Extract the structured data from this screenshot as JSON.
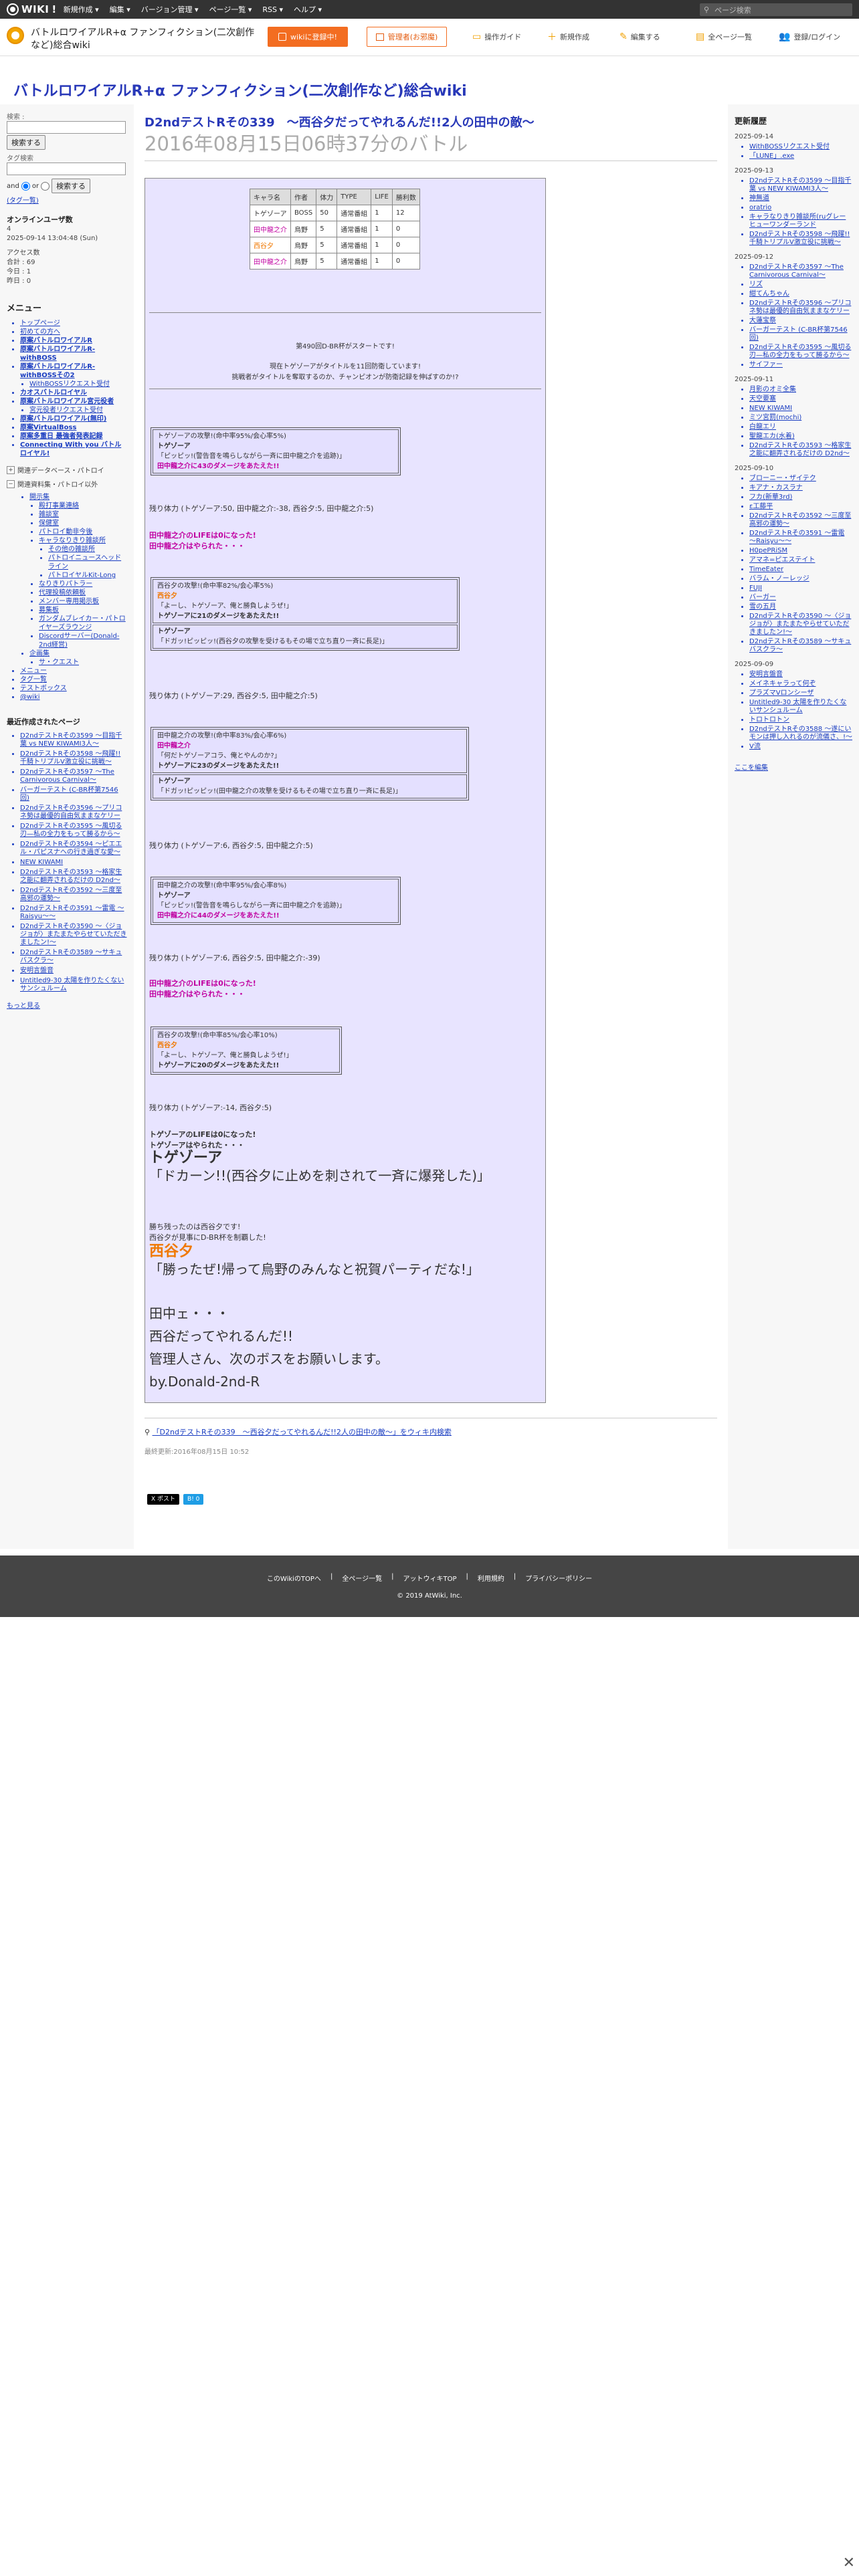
{
  "topbar": {
    "logo": "WIKI",
    "menus": [
      "新規作成 ▾",
      "編集 ▾",
      "バージョン管理 ▾",
      "ページ一覧 ▾",
      "RSS ▾",
      "ヘルプ ▾"
    ],
    "search_placeholder": "ページ検索"
  },
  "header": {
    "site_name": "バトルロワイアルR+α ファンフィクション(二次創作など)総合wiki",
    "wiki_btn": "wikiに登録中!",
    "manage_btn": "管理者(お邪魔)",
    "actions": [
      "操作ガイド",
      "新規作成",
      "編集する",
      "全ページ一覧",
      "登録/ログイン"
    ],
    "site_title": "バトルロワイアルR+α ファンフィクション(二次創作など)総合wiki"
  },
  "left": {
    "search_label": "検索 :",
    "search_btn": "検索する",
    "tag_label": "タグ検索",
    "and_label": "and",
    "or_label": "or",
    "search_btn2": "検索する",
    "tag_list": "(タグ一覧)",
    "online_title": "オンラインユーザ数",
    "online_count": "4",
    "online_time": "2025-09-14 13:04:48 (Sun)",
    "stats_title": "アクセス数",
    "stats": [
      "合計 : 69",
      "今日 : 1",
      "昨日 : 0"
    ],
    "menu_title": "メニュー",
    "menu": [
      {
        "t": "トップページ",
        "c": ""
      },
      {
        "t": "初めての方へ",
        "c": ""
      },
      {
        "t": "原案バトルロワイアルR",
        "c": "b"
      },
      {
        "t": "原案バトルロワイアルR-withBOSS",
        "c": "b"
      },
      {
        "t": "原案バトルロワイアルR-withBOSSその2",
        "c": "b"
      },
      {
        "t": "WithBOSSリクエスト受付",
        "c": "sub"
      },
      {
        "t": "カオスバトルロイヤル",
        "c": "b"
      },
      {
        "t": "原案バトルロワイアル宮元役者",
        "c": "b"
      },
      {
        "t": "宮元役者リクエスト受付",
        "c": "sub"
      },
      {
        "t": "原案バトルロワイアル(無印)",
        "c": "b"
      },
      {
        "t": "原案VirtualBoss",
        "c": "b"
      },
      {
        "t": "原案多重日 最強者発表記録",
        "c": "b"
      },
      {
        "t": "Connecting With you バトルロイヤル!",
        "c": "b"
      }
    ],
    "toggle1": "関連データベース・パトロイ",
    "toggle2": "関連資料集・パトロイ以外",
    "submenu": [
      {
        "t": "開示集",
        "c": "sub"
      },
      {
        "t": "殿打事業連絡",
        "c": "sub2"
      },
      {
        "t": "雑談室",
        "c": "sub2"
      },
      {
        "t": "保健室",
        "c": "sub2"
      },
      {
        "t": "パトロイ動非今後",
        "c": "sub2"
      },
      {
        "t": "キャラなりきり雑談所",
        "c": "sub2"
      },
      {
        "t": "その他の雑談所",
        "c": "sub3"
      },
      {
        "t": "パトロイニュースヘッドライン",
        "c": "sub3"
      },
      {
        "t": "パトロイヤルKit-Long",
        "c": "sub3"
      },
      {
        "t": "なりきりパトラー",
        "c": "sub2"
      },
      {
        "t": "代理投稿依頼板",
        "c": "sub2"
      },
      {
        "t": "メンバー専用掲示板",
        "c": "sub2"
      },
      {
        "t": "募集板",
        "c": "sub2"
      },
      {
        "t": "ガンダムブレイカー・パトロイヤーズラウンジ",
        "c": "sub2"
      },
      {
        "t": "Discordサーバー(Donald-2nd経営)",
        "c": "sub2"
      },
      {
        "t": "企画集",
        "c": "sub"
      },
      {
        "t": "サ・クエスト",
        "c": "sub2"
      },
      {
        "t": "メニュー",
        "c": ""
      },
      {
        "t": "タグ一覧",
        "c": ""
      },
      {
        "t": "テストボックス",
        "c": ""
      },
      {
        "t": "@wiki",
        "c": ""
      }
    ],
    "recent_title": "最近作成されたページ",
    "recent": [
      "D2ndテストRその3599 〜目指千葉 vs NEW KIWAMI3人〜",
      "D2ndテストRその3598 〜飛躍!!千騎トリプルV激立役に挑戦〜",
      "D2ndテストRその3597 〜The Carnivorous Carnival〜",
      "バーガーテスト (C-BR杯第7546回)",
      "D2ndテストRその3596 〜プリコネ勢は最優的自由気ままなケリー",
      "D2ndテストRその3595 〜風切る刃—私の全力をもって勝るから〜",
      "D2ndテストRその3594 〜ピエエル・パピスナへの行き過ぎな愛〜",
      "NEW KIWAMI",
      "D2ndテストRその3593 〜格家生之能に翻弄されるだけの D2nd〜",
      "D2ndテストRその3592 〜三度至高邪の運勢〜",
      "D2ndテストRその3591 〜雷電 〜Raisyu〜〜",
      "D2ndテストRその3590 〜〈ジョジョが〉またまたやらせていただきましたン!〜",
      "D2ndテストRその3589 〜サキュバスクラ〜",
      "安明言盤音",
      "Untitled9-30 太陽を作りたくないサンシュルーム"
    ],
    "recent_more": "もっと見る"
  },
  "page": {
    "title": "D2ndテストRその339　〜西谷夕だってやれるんだ!!2人の田中の敵〜",
    "subtitle": "2016年08月15日06時37分のバトル",
    "table": {
      "headers": [
        "キャラ名",
        "作者",
        "体力",
        "TYPE",
        "LIFE",
        "勝利数"
      ],
      "rows": [
        [
          "トゲゾーア",
          "BOSS",
          "50",
          "通常番組",
          "1",
          "12"
        ],
        [
          "田中龍之介",
          "烏野",
          "5",
          "通常番組",
          "1",
          "0"
        ],
        [
          "西谷夕",
          "烏野",
          "5",
          "通常番組",
          "1",
          "0"
        ],
        [
          "田中龍之介",
          "烏野",
          "5",
          "通常番組",
          "1",
          "0"
        ]
      ]
    },
    "intro1": "第490回D-BR杯がスタートです!",
    "intro2": "現在トゲゾーアがタイトルを11回防衛しています!",
    "intro3": "挑戦者がタイトルを奪取するのか、チャンピオンが防衛記録を伸ばすのか!?",
    "b1": [
      "トゲゾーアの攻撃!(命中率95%/会心率5%)",
      "トゲゾーア",
      "「ピッピッ!(警告音を鳴らしながら一斉に田中龍之介を追跡)」",
      "田中龍之介に43のダメージをあたえた!!"
    ],
    "r1": "残り体力 (トゲゾーア:50, 田中龍之介:-38, 西谷夕:5, 田中龍之介:5)",
    "d1a": "田中龍之介のLIFEは0になった!",
    "d1b": "田中龍之介はやられた・・・",
    "b2a": [
      "西谷夕の攻撃!(命中率82%/会心率5%)",
      "西谷夕",
      "「よーし、トゲゾーア、俺と勝負しようぜ!」",
      "トゲゾーアに21のダメージをあたえた!!"
    ],
    "b2b": [
      "トゲゾーア",
      "「ドガッ!ピッピッ!(西谷夕の攻撃を受けるもその場で立ち直り一斉に長足)」"
    ],
    "r2": "残り体力 (トゲゾーア:29, 西谷夕:5, 田中龍之介:5)",
    "b3a": [
      "田中龍之介の攻撃!(命中率83%/会心率6%)",
      "田中龍之介",
      "「何だトゲゾーアコラ、俺とやんのか?」",
      "トゲゾーアに23のダメージをあたえた!!"
    ],
    "b3b": [
      "トゲゾーア",
      "「ドガッ!ピッピッ!(田中龍之介の攻撃を受けるもその場で立ち直り一斉に長足)」"
    ],
    "r3": "残り体力 (トゲゾーア:6, 西谷夕:5, 田中龍之介:5)",
    "b4": [
      "田中龍之介の攻撃!(命中率95%/会心率8%)",
      "トゲゾーア",
      "「ピッピッ!(警告音を鳴らしながら一斉に田中龍之介を追跡)」",
      "田中龍之介に44のダメージをあたえた!!"
    ],
    "r4": "残り体力 (トゲゾーア:6, 西谷夕:5, 田中龍之介:-39)",
    "d4a": "田中龍之介のLIFEは0になった!",
    "d4b": "田中龍之介はやられた・・・",
    "b5": [
      "西谷夕の攻撃!(命中率85%/会心率10%)",
      "西谷夕",
      "「よーし、トゲゾーア、俺と勝負しようぜ!」",
      "トゲゾーアに20のダメージをあたえた!!"
    ],
    "r5": "残り体力 (トゲゾーア:-14, 西谷夕:5)",
    "d5a": "トゲゾーアのLIFEは0になった!",
    "d5b": "トゲゾーアはやられた・・・",
    "boss_name": "トゲゾーア",
    "boss_line": "「ドカーン!!(西谷夕に止めを刺されて一斉に爆発した)」",
    "w1": "勝ち残ったのは西谷夕です!",
    "w2": "西谷夕が見事にD-BR杯を制覇した!",
    "win_name": "西谷夕",
    "win_line": "「勝ったぜ!帰って烏野のみんなと祝賀パーティだな!」",
    "end1": "田中ェ・・・",
    "end2": "西谷だってやれるんだ!!",
    "end3": "管理人さん、次のボスをお願いします。",
    "end4": "by.Donald-2nd-R",
    "search_note": "「D2ndテストRその339　〜西谷夕だってやれるんだ!!2人の田中の敵〜」をウィキ内検索",
    "updated": "最終更新:2016年08月15日 10:52",
    "share": [
      "X ポスト",
      "B! 0"
    ]
  },
  "right": {
    "title": "更新履歴",
    "days": [
      {
        "d": "2025-09-14",
        "items": [
          "WithBOSSリクエスト受付",
          "「LUNE」.exe"
        ]
      },
      {
        "d": "2025-09-13",
        "items": [
          "D2ndテストRその3599 〜目指千葉 vs NEW KIWAMI3人〜",
          "神無道",
          "oratrio",
          "キャラなりきり雑談所(ruグレーヒューワンダーランド",
          "D2ndテストRその3598 〜飛躍!!千騎トリプルV激立役に挑戦〜"
        ]
      },
      {
        "d": "2025-09-12",
        "items": [
          "D2ndテストRその3597 〜The Carnivorous Carnival〜",
          "リズ",
          "紺てんちゃん",
          "D2ndテストRその3596 〜プリコネ勢は最優的自由気ままなケリー",
          "大蓮宝祭",
          "バーガーテスト (C-BR杯第7546回)",
          "D2ndテストRその3595 〜風切る刃—私の全力をもって勝るから〜",
          "サイファー"
        ]
      },
      {
        "d": "2025-09-11",
        "items": [
          "月影のオミ全集",
          "天空要塞",
          "NEW KIWAMI",
          "ミツ宮罰(mochi)",
          "白龍エリ",
          "聖龍エカ(水着)",
          "D2ndテストRその3593 〜格家生之能に翻弄されるだけの D2nd〜"
        ]
      },
      {
        "d": "2025-09-10",
        "items": [
          "ブローニー・ザイテク",
          "キアナ・カスラナ",
          "フカ(新華3rd)",
          "ε工藤平",
          "D2ndテストRその3592 〜三度至高邪の運勢〜",
          "D2ndテストRその3591 〜雷電 〜Raisyu〜〜",
          "H0pePRiSM",
          "アマネ=ピエステイト",
          "TimeEater",
          "バラム・ノーレッジ",
          "FUJI",
          "バーガー",
          "雪の五月",
          "D2ndテストRその3590 〜〈ジョジョが〉またまたやらせていただきましたン!〜",
          "D2ndテストRその3589 〜サキュバスクラ〜"
        ]
      },
      {
        "d": "2025-09-09",
        "items": [
          "安明言盤音",
          "メイネキャラって何ぞ",
          "プラズマVロンシーザ",
          "Untitled9-30 太陽を作りたくないサンシュルーム",
          "トロトロトン",
          "D2ndテストRその3588 〜遂にいモンは押し入れるのが流儀さ、!〜",
          "V流"
        ]
      }
    ],
    "more": "ここを編集"
  },
  "footer": {
    "links": [
      "このWikiのTOPへ",
      "全ページ一覧",
      "アットウィキTOP",
      "利用規約",
      "プライバシーポリシー"
    ],
    "copy": "2019 AtWiki, Inc."
  }
}
